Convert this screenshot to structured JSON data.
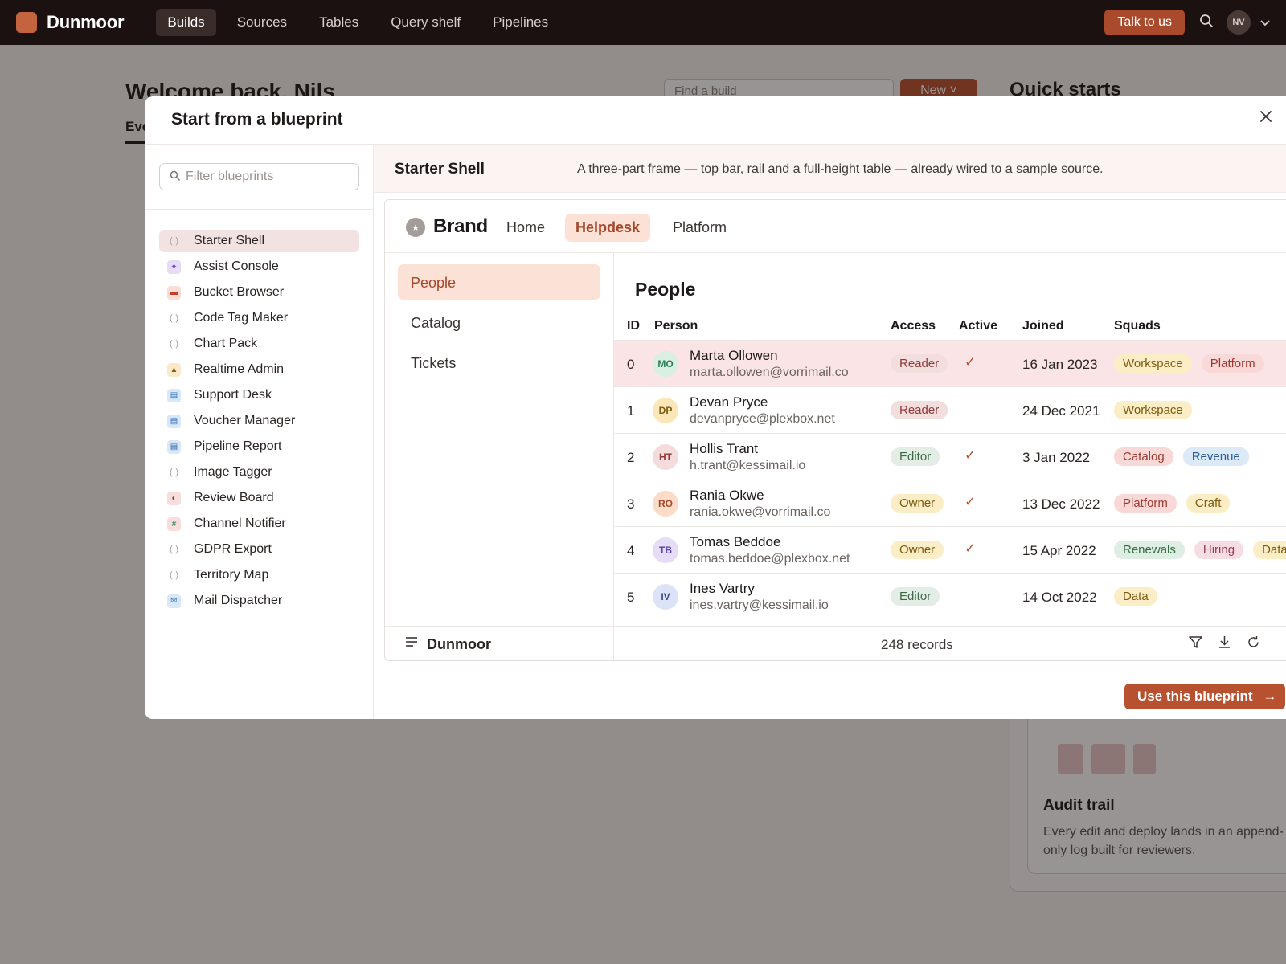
{
  "app": {
    "logo_text": "Dunmoor",
    "nav": [
      "Builds",
      "Sources",
      "Tables",
      "Query shelf",
      "Pipelines"
    ],
    "active_nav": "Builds",
    "talk_label": "Talk to us",
    "avatar_initials": "NV"
  },
  "background": {
    "welcome": "Welcome back, Nils",
    "tab": "Everything",
    "search_placeholder": "Find a build",
    "new_label": "New",
    "quick_starts": "Quick starts",
    "card_title": "Audit trail",
    "card_desc": "Every edit and deploy lands in an append-only log built for reviewers."
  },
  "modal": {
    "title": "Start from a blueprint",
    "close_glyph": "✕",
    "filter_placeholder": "Filter blueprints",
    "blueprints": [
      {
        "label": "Starter Shell",
        "icon": "(·)",
        "style": "ic-plain",
        "selected": true
      },
      {
        "label": "Assist Console",
        "icon": "✦",
        "style": "ic-purple"
      },
      {
        "label": "Bucket Browser",
        "icon": "▬",
        "style": "ic-red"
      },
      {
        "label": "Code Tag Maker",
        "icon": "(·)",
        "style": "ic-plain"
      },
      {
        "label": "Chart Pack",
        "icon": "(·)",
        "style": "ic-plain"
      },
      {
        "label": "Realtime Admin",
        "icon": "▲",
        "style": "ic-amber"
      },
      {
        "label": "Support Desk",
        "icon": "▤",
        "style": "ic-blue"
      },
      {
        "label": "Voucher Manager",
        "icon": "▤",
        "style": "ic-blue"
      },
      {
        "label": "Pipeline Report",
        "icon": "▤",
        "style": "ic-blue"
      },
      {
        "label": "Image Tagger",
        "icon": "(·)",
        "style": "ic-plain"
      },
      {
        "label": "Review Board",
        "icon": "◐",
        "style": "ic-rose"
      },
      {
        "label": "Channel Notifier",
        "icon": "#",
        "style": "ic-green"
      },
      {
        "label": "GDPR Export",
        "icon": "(·)",
        "style": "ic-plain"
      },
      {
        "label": "Territory Map",
        "icon": "(·)",
        "style": "ic-plain"
      },
      {
        "label": "Mail Dispatcher",
        "icon": "✉",
        "style": "ic-blue"
      }
    ],
    "selected": {
      "name": "Starter Shell",
      "description": "A three-part frame — top bar, rail and a full-height table — already wired to a sample source."
    },
    "use_label": "Use this blueprint",
    "use_arrow": "→"
  },
  "preview": {
    "brand": "Brand",
    "brand_glyph": "★",
    "nav": [
      "Home",
      "Helpdesk",
      "Platform"
    ],
    "active_nav": "Helpdesk",
    "rail": [
      "People",
      "Catalog",
      "Tickets"
    ],
    "active_rail": "People",
    "title": "People",
    "columns": [
      "ID",
      "Person",
      "Access",
      "Active",
      "Joined",
      "Squads"
    ],
    "rows": [
      {
        "id": "0",
        "initials": "MO",
        "name": "Marta Ollowen",
        "email": "marta.ollowen@vorrimail.co",
        "access": "Reader",
        "active": true,
        "joined": "16 Jan 2023",
        "squads": [
          "Workspace",
          "Platform"
        ]
      },
      {
        "id": "1",
        "initials": "DP",
        "name": "Devan Pryce",
        "email": "devanpryce@plexbox.net",
        "access": "Reader",
        "active": false,
        "joined": "24 Dec 2021",
        "squads": [
          "Workspace"
        ]
      },
      {
        "id": "2",
        "initials": "HT",
        "name": "Hollis Trant",
        "email": "h.trant@kessimail.io",
        "access": "Editor",
        "active": true,
        "joined": "3 Jan 2022",
        "squads": [
          "Catalog",
          "Revenue"
        ]
      },
      {
        "id": "3",
        "initials": "RO",
        "name": "Rania Okwe",
        "email": "rania.okwe@vorrimail.co",
        "access": "Owner",
        "active": true,
        "joined": "13 Dec 2022",
        "squads": [
          "Platform",
          "Craft"
        ]
      },
      {
        "id": "4",
        "initials": "TB",
        "name": "Tomas Beddoe",
        "email": "tomas.beddoe@plexbox.net",
        "access": "Owner",
        "active": true,
        "joined": "15 Apr 2022",
        "squads": [
          "Renewals",
          "Hiring",
          "Data"
        ]
      },
      {
        "id": "5",
        "initials": "IV",
        "name": "Ines Vartry",
        "email": "ines.vartry@kessimail.io",
        "access": "Editor",
        "active": false,
        "joined": "14 Oct 2022",
        "squads": [
          "Data"
        ]
      }
    ],
    "footer_brand": "Dunmoor",
    "records": "248 records",
    "check_glyph": "✓",
    "icons": {
      "menu": "≡",
      "filter": "⛉",
      "download": "⤓",
      "refresh": "↻",
      "search": "⌕"
    }
  },
  "colors": {
    "accent": "#b8512f",
    "topbar": "#1a1110",
    "highlight_row": "#fbe4e5",
    "selected_item": "#f3e2e2"
  }
}
